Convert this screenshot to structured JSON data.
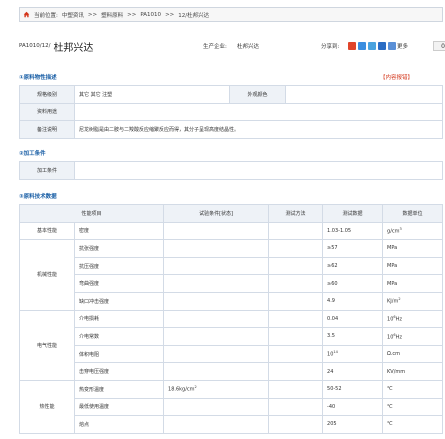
{
  "breadcrumb": {
    "location_label": "当前位置:",
    "items": [
      "中塑资讯",
      "塑料原料",
      "PA1010",
      "12/杜邦兴达"
    ],
    "separator": ">>"
  },
  "product": {
    "code": "PA1010/12/",
    "name": "杜邦兴达",
    "maker_label": "生产企业:",
    "maker": "杜邦兴达"
  },
  "share": {
    "label": "分享到:",
    "more": "更多",
    "count": "0"
  },
  "sections": {
    "desc_title": "①原料物性描述",
    "error_link": "【内容报错】",
    "process_title": "②加工条件",
    "tech_title": "③原料技术数据"
  },
  "desc": {
    "grade_label": "规格级别",
    "grade_value": "其它 其它 注塑",
    "color_label": "外观颜色",
    "color_value": "",
    "usage_label": "资料用途",
    "usage_value": "",
    "note_label": "备注说明",
    "note_value": "尼龙树脂是由二胺与二羧酸反应缩聚反应而得，其分子呈现高度结晶性。"
  },
  "process": {
    "label": "加工条件",
    "value": ""
  },
  "tech": {
    "headers": [
      "性能项目",
      "试验条件[状态]",
      "测试方法",
      "测试数据",
      "数据单位"
    ],
    "groups": [
      {
        "name": "基本性能",
        "rows": [
          {
            "item": "密度",
            "cond": "",
            "method": "",
            "value": "1.03-1.05",
            "unit": "g/cm",
            "unit_sup": "3"
          }
        ]
      },
      {
        "name": "机械性能",
        "rows": [
          {
            "item": "抗张强度",
            "cond": "",
            "method": "",
            "value": "≥57",
            "unit": "MPa",
            "unit_sup": ""
          },
          {
            "item": "抗压强度",
            "cond": "",
            "method": "",
            "value": "≥62",
            "unit": "MPa",
            "unit_sup": ""
          },
          {
            "item": "弯曲强度",
            "cond": "",
            "method": "",
            "value": "≥60",
            "unit": "MPa",
            "unit_sup": ""
          },
          {
            "item": "缺口冲击强度",
            "cond": "",
            "method": "",
            "value": "4.9",
            "unit": "KJ/m",
            "unit_sup": "2"
          }
        ]
      },
      {
        "name": "电气性能",
        "rows": [
          {
            "item": "介电损耗",
            "cond": "",
            "method": "",
            "value": "0.04",
            "unit": "10",
            "unit_sup": "6",
            "unit_tail": "Hz"
          },
          {
            "item": "介电常数",
            "cond": "",
            "method": "",
            "value": "3.5",
            "unit": "10",
            "unit_sup": "6",
            "unit_tail": "Hz"
          },
          {
            "item": "体积电阻",
            "cond": "",
            "method": "",
            "value": "10",
            "value_sup": "14",
            "unit": "Ω.cm",
            "unit_sup": ""
          },
          {
            "item": "击穿电压强度",
            "cond": "",
            "method": "",
            "value": "24",
            "unit": "KV/mm",
            "unit_sup": ""
          }
        ]
      },
      {
        "name": "热性能",
        "rows": [
          {
            "item": "热变形温度",
            "cond": "18.6kg/cm",
            "cond_sup": "2",
            "method": "",
            "value": "50-52",
            "unit": "℃",
            "unit_sup": ""
          },
          {
            "item": "最低使用温度",
            "cond": "",
            "method": "",
            "value": "-40",
            "unit": "℃",
            "unit_sup": ""
          },
          {
            "item": "熔点",
            "cond": "",
            "method": "",
            "value": "205",
            "unit": "℃",
            "unit_sup": ""
          }
        ]
      }
    ]
  },
  "colors": {
    "accent": "#1a5fa6",
    "error": "#d4361b",
    "border": "#d3dbe6",
    "label_bg": "#eef2f7"
  }
}
